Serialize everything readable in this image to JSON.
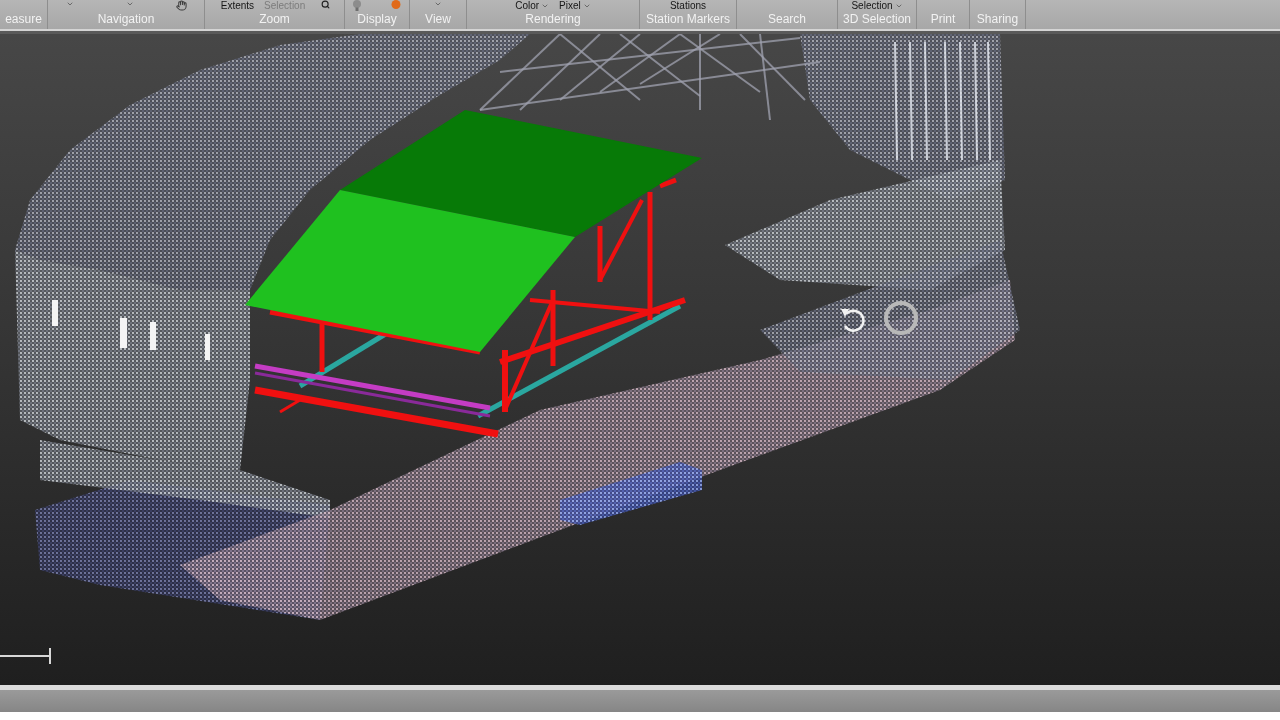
{
  "ribbon": {
    "groups": [
      {
        "label": "easure"
      },
      {
        "label": "Navigation"
      },
      {
        "label": "Zoom",
        "items": [
          {
            "kind": "text",
            "label": "Extents",
            "disabled": false
          },
          {
            "kind": "text",
            "label": "Selection",
            "disabled": true
          }
        ]
      },
      {
        "label": "Display"
      },
      {
        "label": "View"
      },
      {
        "label": "Rendering",
        "items": [
          {
            "kind": "dropdown",
            "label": "Color",
            "disabled": false
          },
          {
            "kind": "dropdown",
            "label": "Pixel",
            "disabled": false
          }
        ]
      },
      {
        "label": "Station Markers",
        "items": [
          {
            "kind": "text",
            "label": "Stations",
            "disabled": false
          }
        ]
      },
      {
        "label": "Search"
      },
      {
        "label": "3D Selection",
        "items": [
          {
            "kind": "dropdown",
            "label": "Selection",
            "disabled": false
          }
        ]
      },
      {
        "label": "Print"
      },
      {
        "label": "Sharing"
      }
    ]
  }
}
